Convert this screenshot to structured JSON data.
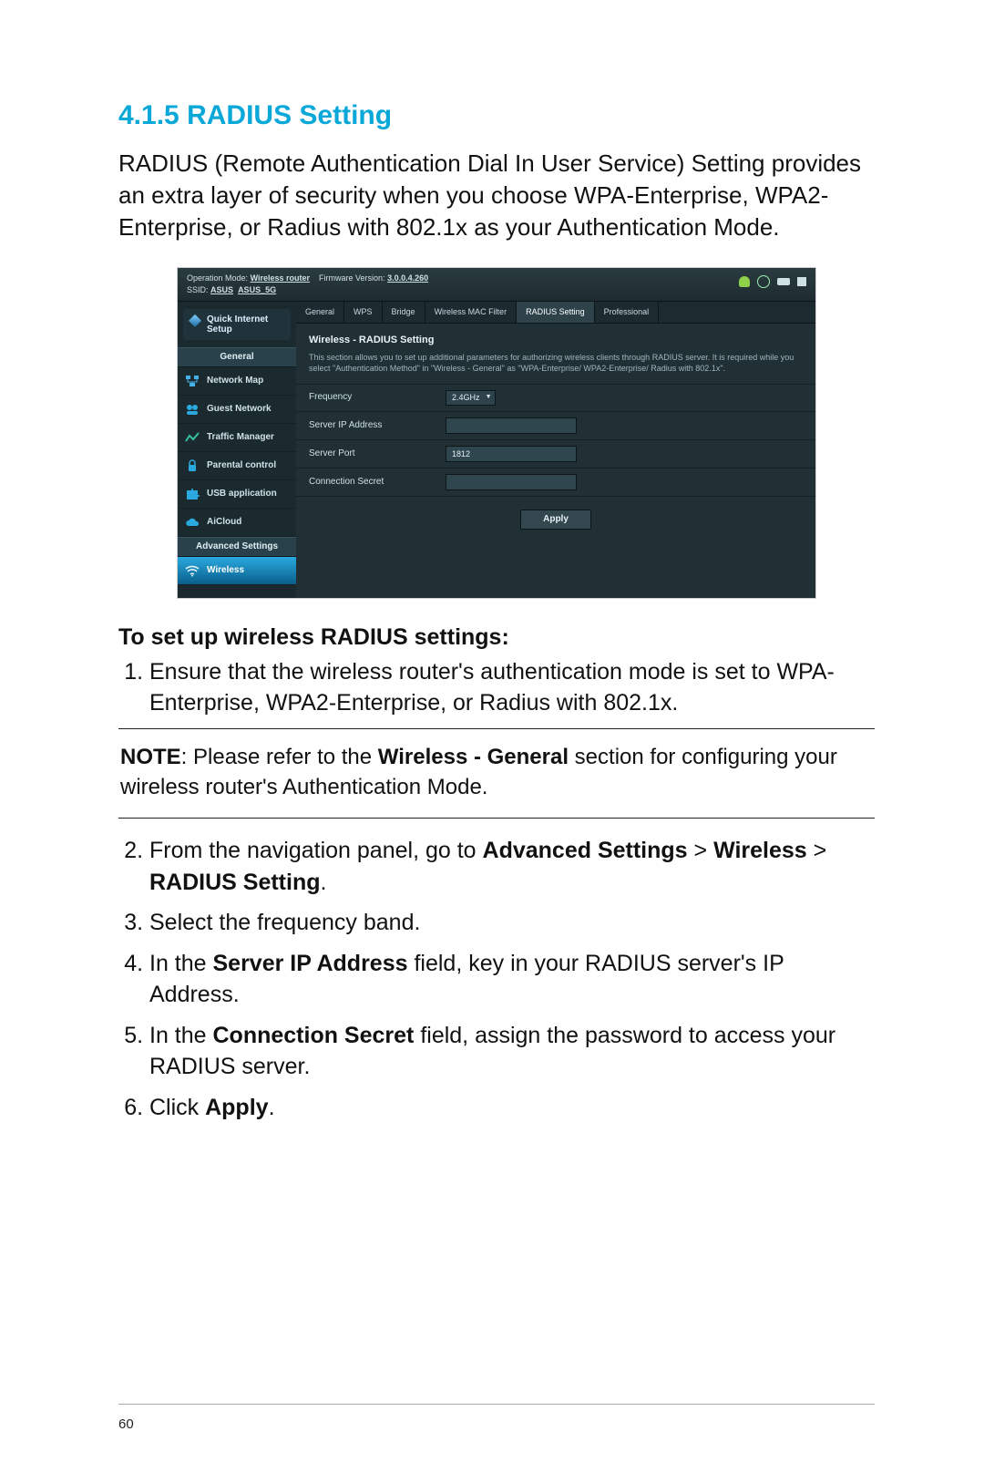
{
  "section": {
    "number": "4.1.5",
    "title": "RADIUS Setting",
    "intro": "RADIUS (Remote Authentication Dial In User Service) Setting provides an extra layer of security when you choose WPA-Enterprise, WPA2-Enterprise, or Radius with 802.1x as your Authentication Mode."
  },
  "router": {
    "top": {
      "op_mode_label": "Operation Mode:",
      "op_mode_value": "Wireless router",
      "fw_label": "Firmware Version:",
      "fw_value": "3.0.0.4.260",
      "ssid_label": "SSID:",
      "ssid1": "ASUS",
      "ssid2": "ASUS_5G"
    },
    "sidebar": {
      "quick": "Quick Internet Setup",
      "general_header": "General",
      "items": [
        {
          "label": "Network Map"
        },
        {
          "label": "Guest Network"
        },
        {
          "label": "Traffic Manager"
        },
        {
          "label": "Parental control"
        },
        {
          "label": "USB application"
        },
        {
          "label": "AiCloud"
        }
      ],
      "adv_header": "Advanced Settings",
      "adv_active": "Wireless"
    },
    "tabs": [
      "General",
      "WPS",
      "Bridge",
      "Wireless MAC Filter",
      "RADIUS Setting",
      "Professional"
    ],
    "active_tab_index": 4,
    "panel": {
      "title": "Wireless - RADIUS Setting",
      "desc": "This section allows you to set up additional parameters for authorizing wireless clients through RADIUS server. It is required while you select \"Authentication Method\" in \"Wireless - General\" as \"WPA-Enterprise/ WPA2-Enterprise/ Radius with 802.1x\".",
      "rows": {
        "frequency_label": "Frequency",
        "frequency_value": "2.4GHz",
        "server_ip_label": "Server IP Address",
        "server_ip_value": "",
        "server_port_label": "Server Port",
        "server_port_value": "1812",
        "secret_label": "Connection Secret",
        "secret_value": ""
      },
      "apply": "Apply"
    }
  },
  "instructions": {
    "subhead": "To set up wireless RADIUS settings:",
    "step1": "Ensure that the wireless router's authentication mode is set to WPA-Enterprise, WPA2-Enterprise, or Radius with 802.1x.",
    "note_prefix": "NOTE",
    "note_body1": ":  Please refer to the ",
    "note_bold": "Wireless - General",
    "note_body2": " section for configuring your wireless router's Authentication Mode.",
    "step2_a": "From the navigation panel, go to ",
    "step2_b": "Advanced Settings",
    "step2_c": " > ",
    "step2_d": "Wireless",
    "step2_e": " > ",
    "step2_f": "RADIUS Setting",
    "step2_g": ".",
    "step3": "Select the frequency band.",
    "step4_a": "In the ",
    "step4_b": "Server IP Address",
    "step4_c": " field, key in your RADIUS server's IP Address.",
    "step5_a": "In the ",
    "step5_b": "Connection Secret",
    "step5_c": " field, assign the password to access your RADIUS server.",
    "step6_a": "Click ",
    "step6_b": "Apply",
    "step6_c": "."
  },
  "page_number": "60"
}
